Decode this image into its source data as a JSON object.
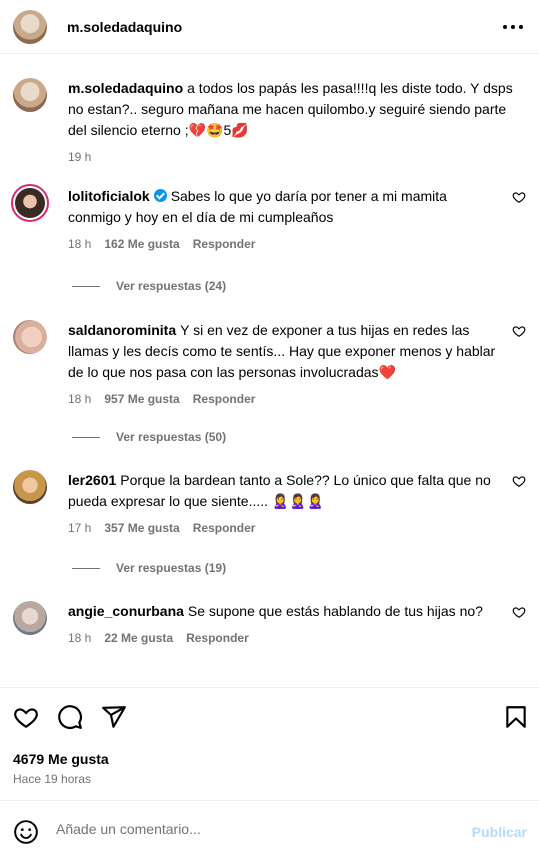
{
  "header": {
    "username": "m.soledadaquino"
  },
  "caption": {
    "username": "m.soledadaquino",
    "text": "a todos los papás les pasa!!!!q les diste todo. Y dsps no estan?.. seguro mañana me hacen quilombo.y seguiré siendo parte del silencio eterno ;",
    "emoji_tail": "💔🤩5💋",
    "time": "19 h"
  },
  "comments": [
    {
      "username": "lolitoficialok",
      "verified": true,
      "text": "Sabes lo que yo daría por tener a mi mamita conmigo y hoy en el día de mi cumpleaños",
      "time": "18 h",
      "likes": "162 Me gusta",
      "reply": "Responder",
      "view_replies": "Ver respuestas (24)"
    },
    {
      "username": "saldanorominita",
      "text": "Y si en vez de exponer a tus hijas en redes las llamas y les decís como te sentís... Hay que exponer menos y hablar de lo que nos pasa con las personas involucradas",
      "emoji_tail": "❤️",
      "time": "18 h",
      "likes": "957 Me gusta",
      "reply": "Responder",
      "view_replies": "Ver respuestas (50)"
    },
    {
      "username": "ler2601",
      "text": "Porque la bardean tanto a Sole?? Lo único que falta que no pueda expresar lo que siente.....",
      "emoji_tail": "🙎‍♀️🙎‍♀️🙎‍♀️",
      "time": "17 h",
      "likes": "357 Me gusta",
      "reply": "Responder",
      "view_replies": "Ver respuestas (19)"
    },
    {
      "username": "angie_conurbana",
      "text": "Se supone que estás hablando de tus hijas no?",
      "time": "18 h",
      "likes": "22 Me gusta",
      "reply": "Responder"
    }
  ],
  "footer": {
    "likes_total": "4679 Me gusta",
    "time_ago": "Hace 19 horas",
    "comment_placeholder": "Añade un comentario...",
    "publish_label": "Publicar"
  },
  "colors": {
    "secondary_text": "#737373",
    "verified_blue": "#0095f6",
    "publish_disabled": "#b3dbff",
    "divider": "#efefef"
  },
  "icons": {
    "more": "more-horizontal-icon",
    "like": "heart-icon",
    "comment": "comment-bubble-icon",
    "share": "paper-plane-icon",
    "save": "bookmark-icon",
    "emoji": "smiley-icon"
  }
}
